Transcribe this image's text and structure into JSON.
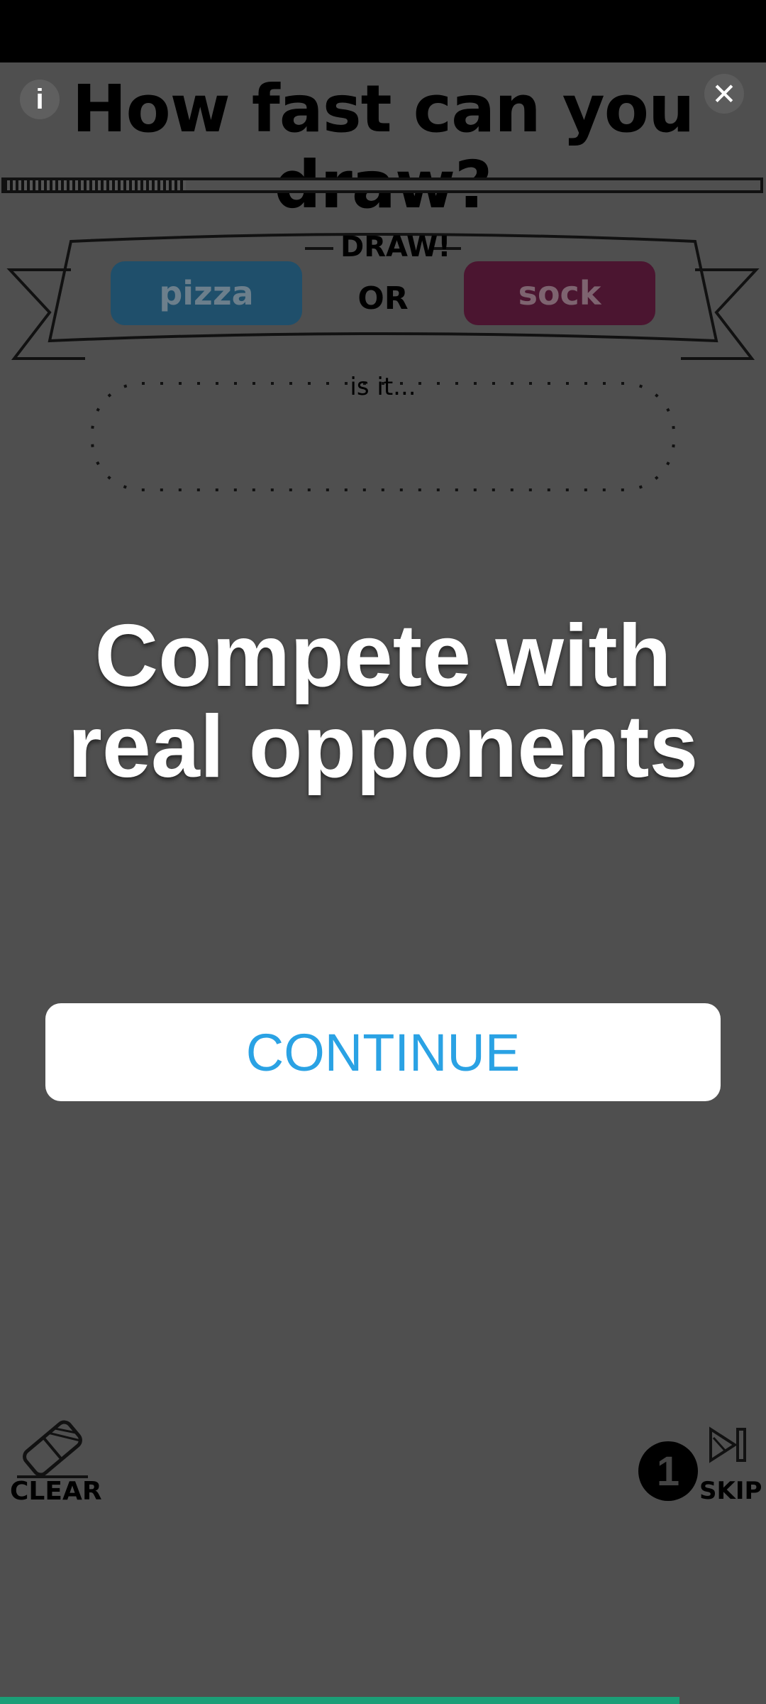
{
  "game": {
    "title": "How fast can you draw?",
    "info_label": "i",
    "close_label": "✕"
  },
  "progress": {
    "value": 0.24
  },
  "prompt": {
    "draw_label": "DRAW!",
    "or_label": "OR",
    "option_a": "pizza",
    "option_b": "sock",
    "guess_label": "is it..."
  },
  "overlay": {
    "headline": "Compete with real opponents",
    "continue_label": "CONTINUE"
  },
  "controls": {
    "clear_label": "CLEAR",
    "skip_label": "SKIP",
    "skip_count": "1"
  },
  "colors": {
    "background": "#4f4f4f",
    "option_a": "#1f4f6b",
    "option_b": "#4b1530",
    "continue_text": "#2aa2e4",
    "bottom_indicator": "#1b9e77"
  }
}
